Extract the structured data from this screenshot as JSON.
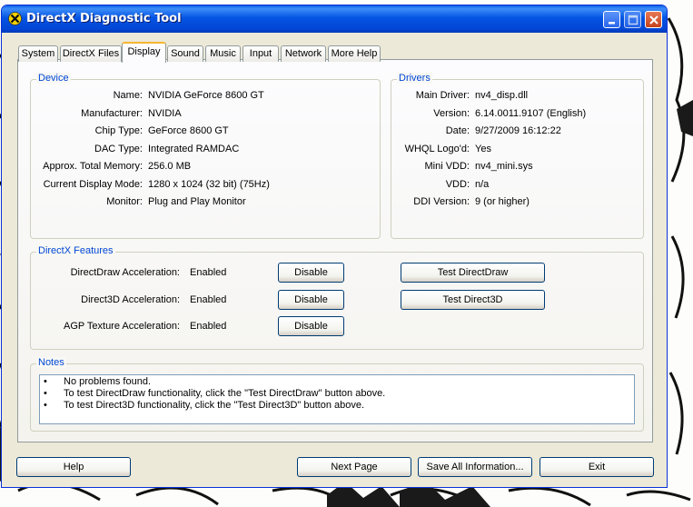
{
  "window": {
    "title": "DirectX Diagnostic Tool"
  },
  "tabs": [
    {
      "label": "System"
    },
    {
      "label": "DirectX Files"
    },
    {
      "label": "Display"
    },
    {
      "label": "Sound"
    },
    {
      "label": "Music"
    },
    {
      "label": "Input"
    },
    {
      "label": "Network"
    },
    {
      "label": "More Help"
    }
  ],
  "device": {
    "heading": "Device",
    "fields": [
      {
        "label": "Name:",
        "value": "NVIDIA GeForce 8600 GT"
      },
      {
        "label": "Manufacturer:",
        "value": "NVIDIA"
      },
      {
        "label": "Chip Type:",
        "value": "GeForce 8600 GT"
      },
      {
        "label": "DAC Type:",
        "value": "Integrated RAMDAC"
      },
      {
        "label": "Approx. Total Memory:",
        "value": "256.0 MB"
      },
      {
        "label": "Current Display Mode:",
        "value": "1280 x 1024 (32 bit) (75Hz)"
      },
      {
        "label": "Monitor:",
        "value": "Plug and Play Monitor"
      }
    ]
  },
  "drivers": {
    "heading": "Drivers",
    "fields": [
      {
        "label": "Main Driver:",
        "value": "nv4_disp.dll"
      },
      {
        "label": "Version:",
        "value": "6.14.0011.9107 (English)"
      },
      {
        "label": "Date:",
        "value": "9/27/2009 16:12:22"
      },
      {
        "label": "WHQL Logo'd:",
        "value": "Yes"
      },
      {
        "label": "Mini VDD:",
        "value": "nv4_mini.sys"
      },
      {
        "label": "VDD:",
        "value": "n/a"
      },
      {
        "label": "DDI Version:",
        "value": "9 (or higher)"
      }
    ]
  },
  "features": {
    "heading": "DirectX Features",
    "items": [
      {
        "label": "DirectDraw Acceleration:",
        "value": "Enabled",
        "button": "Disable",
        "test": "Test DirectDraw"
      },
      {
        "label": "Direct3D Acceleration:",
        "value": "Enabled",
        "button": "Disable",
        "test": "Test Direct3D"
      },
      {
        "label": "AGP Texture Acceleration:",
        "value": "Enabled",
        "button": "Disable"
      }
    ]
  },
  "notes": {
    "heading": "Notes",
    "bullet": "•",
    "lines": [
      "No problems found.",
      "To test DirectDraw functionality, click the \"Test DirectDraw\" button above.",
      "To test Direct3D functionality, click the \"Test Direct3D\" button above."
    ]
  },
  "footer": {
    "help": "Help",
    "next": "Next Page",
    "save": "Save All Information...",
    "exit": "Exit"
  }
}
